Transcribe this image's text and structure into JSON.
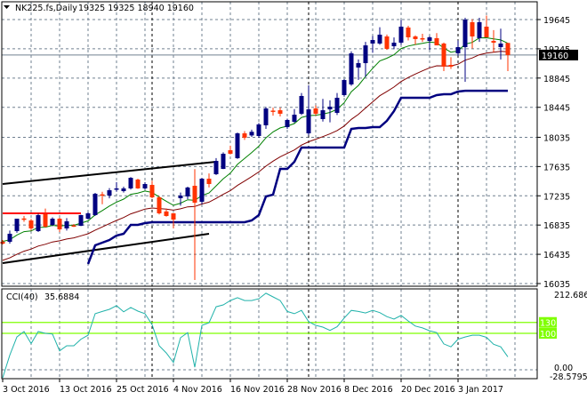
{
  "header": {
    "symbol": "NK225.fs,Daily",
    "ohlc_text": "19325 19325 18940 19160",
    "menu_icon": "triangle-down-icon"
  },
  "colors": {
    "bull": "#000080",
    "bear": "#ff3300",
    "ma_fast": "#008000",
    "ma_slow": "#800000",
    "stop_line": "#000080",
    "trendline": "#000000",
    "resistance": "#ff0000",
    "cci": "#20b2aa",
    "cci_levels": "#7fff00",
    "grid": "#708090"
  },
  "chart_data": [
    {
      "type": "candlestick",
      "title": "NK225.fs,Daily",
      "current_price_label": "19160",
      "current_price": 19160,
      "ylim": [
        16035,
        19645
      ],
      "y_ticks": [
        "19645",
        "19245",
        "18845",
        "18445",
        "18035",
        "17635",
        "17235",
        "16835",
        "16435",
        "16035"
      ],
      "y_tick_values": [
        19645,
        19245,
        18845,
        18445,
        18035,
        17635,
        17235,
        16835,
        16435,
        16035
      ],
      "x_tick_labels": [
        "3 Oct 2016",
        "13 Oct 2016",
        "25 Oct 2016",
        "4 Nov 2016",
        "16 Nov 2016",
        "28 Nov 2016",
        "8 Dec 2016",
        "20 Dec 2016",
        "3 Jan 2017"
      ],
      "x_tick_bar_index": [
        0,
        8,
        16,
        24,
        32,
        40,
        48,
        56,
        64
      ],
      "period_separators_bar_index": [
        21,
        43,
        64
      ],
      "grid": true,
      "ohlc": [
        [
          16606,
          16630,
          16570,
          16580
        ],
        [
          16606,
          16760,
          16580,
          16716
        ],
        [
          16752,
          16922,
          16730,
          16922
        ],
        [
          16925,
          16960,
          16880,
          16910
        ],
        [
          16898,
          16920,
          16760,
          16789
        ],
        [
          16752,
          16990,
          16740,
          16971
        ],
        [
          16983,
          17060,
          16800,
          16813
        ],
        [
          16837,
          16940,
          16820,
          16922
        ],
        [
          16922,
          16935,
          16740,
          16776
        ],
        [
          16789,
          16930,
          16760,
          16886
        ],
        [
          16830,
          16850,
          16810,
          16820
        ],
        [
          16825,
          16975,
          16820,
          16971
        ],
        [
          16922,
          17010,
          16910,
          16995
        ],
        [
          16971,
          17275,
          16960,
          17263
        ],
        [
          17255,
          17290,
          17120,
          17240
        ],
        [
          17238,
          17340,
          17200,
          17311
        ],
        [
          17323,
          17420,
          17290,
          17336
        ],
        [
          17299,
          17360,
          17280,
          17336
        ],
        [
          17336,
          17490,
          17320,
          17481
        ],
        [
          17457,
          17470,
          17330,
          17336
        ],
        [
          17336,
          17420,
          17320,
          17396
        ],
        [
          17384,
          17440,
          17200,
          17214
        ],
        [
          17214,
          17230,
          16980,
          16995
        ],
        [
          17021,
          17060,
          16950,
          16959
        ],
        [
          16995,
          17000,
          16790,
          16910
        ],
        [
          17202,
          17280,
          17100,
          17238
        ],
        [
          17226,
          17360,
          17190,
          17348
        ],
        [
          17372,
          17600,
          16084,
          17141
        ],
        [
          17153,
          17480,
          17120,
          17469
        ],
        [
          17469,
          17540,
          17350,
          17396
        ],
        [
          17530,
          17750,
          17520,
          17712
        ],
        [
          17603,
          17830,
          17600,
          17810
        ],
        [
          17858,
          17920,
          17800,
          17810
        ],
        [
          17749,
          18100,
          17740,
          18089
        ],
        [
          18089,
          18120,
          18000,
          18029
        ],
        [
          18060,
          18140,
          18040,
          18110
        ],
        [
          18053,
          18230,
          18030,
          18211
        ],
        [
          18199,
          18450,
          18150,
          18429
        ],
        [
          18400,
          18440,
          18330,
          18393
        ],
        [
          18405,
          18440,
          18320,
          18357
        ],
        [
          18174,
          18290,
          18150,
          18272
        ],
        [
          18247,
          18420,
          18230,
          18344
        ],
        [
          18357,
          18640,
          18340,
          18600
        ],
        [
          18089,
          18746,
          18060,
          18417
        ],
        [
          18429,
          18470,
          18330,
          18357
        ],
        [
          18284,
          18560,
          18250,
          18405
        ],
        [
          18417,
          18540,
          18240,
          18454
        ],
        [
          18369,
          18640,
          18340,
          18575
        ],
        [
          18612,
          18830,
          18590,
          18818
        ],
        [
          18758,
          19210,
          18740,
          19183
        ],
        [
          18989,
          19100,
          18820,
          19049
        ],
        [
          19049,
          19340,
          18860,
          19292
        ],
        [
          19317,
          19420,
          19190,
          19365
        ],
        [
          19317,
          19540,
          19300,
          19438
        ],
        [
          19414,
          19440,
          19230,
          19244
        ],
        [
          19280,
          19400,
          19240,
          19329
        ],
        [
          19329,
          19640,
          19300,
          19548
        ],
        [
          19536,
          19560,
          19360,
          19402
        ],
        [
          19414,
          19430,
          19300,
          19378
        ],
        [
          19390,
          19450,
          19340,
          19378
        ],
        [
          19353,
          19420,
          19230,
          19402
        ],
        [
          19390,
          19460,
          19300,
          19292
        ],
        [
          19317,
          19330,
          18940,
          19001
        ],
        [
          19025,
          19130,
          18970,
          19001
        ],
        [
          19183,
          19360,
          19150,
          19268
        ],
        [
          19268,
          19670,
          18794,
          19645
        ],
        [
          19609,
          19650,
          19250,
          19414
        ],
        [
          19390,
          19670,
          19340,
          19609
        ],
        [
          19548,
          19700,
          19400,
          19402
        ],
        [
          19353,
          19500,
          19200,
          19329
        ],
        [
          19268,
          19520,
          19100,
          19317
        ],
        [
          19325,
          19325,
          18940,
          19160
        ]
      ],
      "ma_fast": {
        "period": 8,
        "seed": 16620
      },
      "ma_slow": {
        "period": 21,
        "seed": 16330
      },
      "stop_line": [
        null,
        null,
        null,
        null,
        null,
        null,
        null,
        null,
        null,
        null,
        null,
        null,
        16302,
        16558,
        16594,
        16631,
        16691,
        16716,
        16837,
        16837,
        16861,
        16874,
        16874,
        16874,
        16874,
        16874,
        16874,
        16874,
        16874,
        16874,
        16874,
        16874,
        16874,
        16874,
        16874,
        16898,
        16971,
        17226,
        17250,
        17603,
        17603,
        17700,
        17895,
        17895,
        17895,
        17895,
        17895,
        17895,
        17895,
        18150,
        18162,
        18162,
        18174,
        18174,
        18260,
        18393,
        18575,
        18575,
        18575,
        18575,
        18575,
        18612,
        18624,
        18624,
        18660,
        18672,
        18672,
        18672,
        18672,
        18672,
        18672,
        18672
      ],
      "trendlines": [
        {
          "name": "upper-channel",
          "from": [
            0,
            17396
          ],
          "to": [
            30,
            17700
          ]
        },
        {
          "name": "lower-channel",
          "from": [
            0,
            16315
          ],
          "to": [
            29,
            16716
          ]
        }
      ],
      "resistance": {
        "from_bar": 0,
        "to_bar": 11,
        "price": 16995
      }
    },
    {
      "type": "line",
      "title": "CCI(40)",
      "value_label": "35.6884",
      "ylim": [
        -28.5795,
        212.6862
      ],
      "y_tick_labels": [
        "212.6862",
        "0.00",
        "-28.5795"
      ],
      "levels": [
        130,
        100
      ],
      "level_labels": [
        "130",
        "100"
      ],
      "values": [
        -22,
        40,
        90,
        105,
        72,
        105,
        100,
        98,
        52,
        66,
        66,
        84,
        95,
        154,
        160,
        166,
        176,
        159,
        171,
        161,
        154,
        124,
        66,
        46,
        20,
        88,
        102,
        7,
        122,
        129,
        173,
        178,
        190,
        198,
        190,
        190,
        195,
        210,
        200,
        190,
        160,
        154,
        163,
        132,
        122,
        117,
        108,
        118,
        142,
        163,
        160,
        156,
        163,
        157,
        146,
        139,
        149,
        134,
        120,
        115,
        107,
        102,
        71,
        63,
        84,
        90,
        95,
        95,
        89,
        70,
        63,
        35.6884
      ]
    }
  ]
}
